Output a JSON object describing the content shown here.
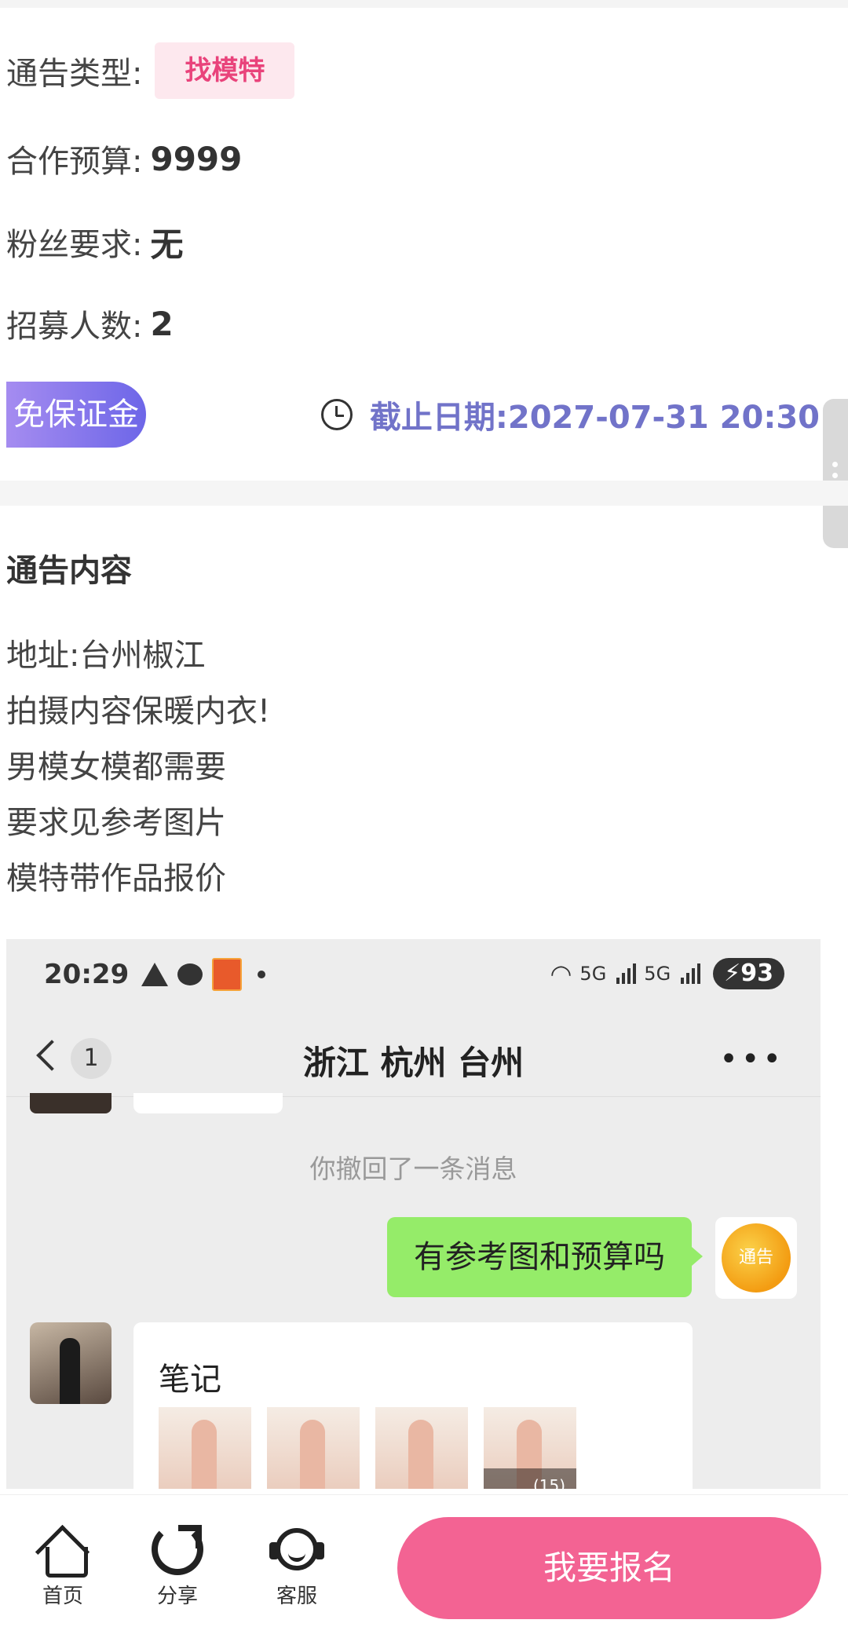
{
  "notice": {
    "type_label": "通告类型:",
    "type_value": "找模特",
    "budget_label": "合作预算:",
    "budget_value": "9999",
    "fans_label": "粉丝要求:",
    "fans_value": "无",
    "recruit_label": "招募人数:",
    "recruit_value": "2",
    "deposit_badge": "免保证金",
    "deadline": "截止日期:2027-07-31 20:30"
  },
  "content_section": {
    "title": "通告内容",
    "lines": [
      "地址:台州椒江",
      "拍摄内容保暖内衣!",
      "男模女模都需要",
      "要求见参考图片",
      "模特带作品报价"
    ]
  },
  "embedded_screenshot": {
    "time": "20:29",
    "net_5g_1": "5G",
    "net_5g_2": "5G",
    "battery": "93",
    "back_count": "1",
    "chat_title": "浙江 杭州 台州",
    "more": "•••",
    "recall_notice": "你撤回了一条消息",
    "my_message": "有参考图和预算吗",
    "my_avatar_text": "通告",
    "note_title": "笔记",
    "thumb_count": "(15)"
  },
  "bottom_bar": {
    "home_label": "首页",
    "share_label": "分享",
    "service_label": "客服",
    "apply_button": "我要报名"
  },
  "colors": {
    "tag_bg": "#fde8ee",
    "tag_text": "#e9437b",
    "deadline_text": "#7173c9",
    "apply_button": "#f36393",
    "chat_bubble_green": "#95ec69"
  }
}
